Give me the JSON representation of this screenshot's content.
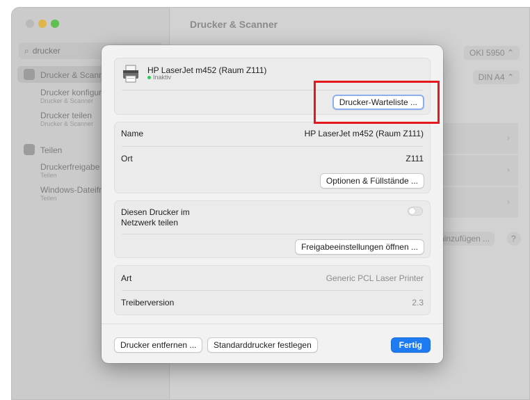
{
  "window": {
    "title": "Drucker & Scanner",
    "search_value": "drucker"
  },
  "sidebar": {
    "items": [
      {
        "label": "Drucker & Scanner",
        "selected": true
      },
      {
        "label": "Drucker konfigurieren",
        "sub": "Drucker & Scanner"
      },
      {
        "label": "Drucker teilen",
        "sub": "Drucker & Scanner"
      },
      {
        "label": "Teilen"
      },
      {
        "label": "Druckerfreigabe",
        "sub": "Teilen"
      },
      {
        "label": "Windows-Dateifreigabe",
        "sub": "Teilen"
      }
    ]
  },
  "background": {
    "default_printer": "OKI 5950",
    "paper_size": "DIN A4",
    "add_button": "hinzufügen ...",
    "help": "?"
  },
  "dialog": {
    "printer_name": "HP LaserJet m452 (Raum Z111)",
    "status": "Inaktiv",
    "status_color": "#34c759",
    "queue_button": "Drucker-Warteliste ...",
    "rows": {
      "name_label": "Name",
      "name_value": "HP LaserJet m452 (Raum Z111)",
      "ort_label": "Ort",
      "ort_value": "Z111",
      "options_button": "Optionen & Füllstände ..."
    },
    "share": {
      "label": "Diesen Drucker im Netzwerk teilen",
      "enabled": false,
      "settings_button": "Freigabeeinstellungen öffnen ..."
    },
    "info": {
      "art_label": "Art",
      "art_value": "Generic PCL Laser Printer",
      "driver_label": "Treiberversion",
      "driver_value": "2.3"
    },
    "footer": {
      "remove_button": "Drucker entfernen ...",
      "default_button": "Standarddrucker festlegen",
      "done_button": "Fertig"
    }
  },
  "accent_color": "#1f7bf2",
  "highlight_color": "#e3191f"
}
